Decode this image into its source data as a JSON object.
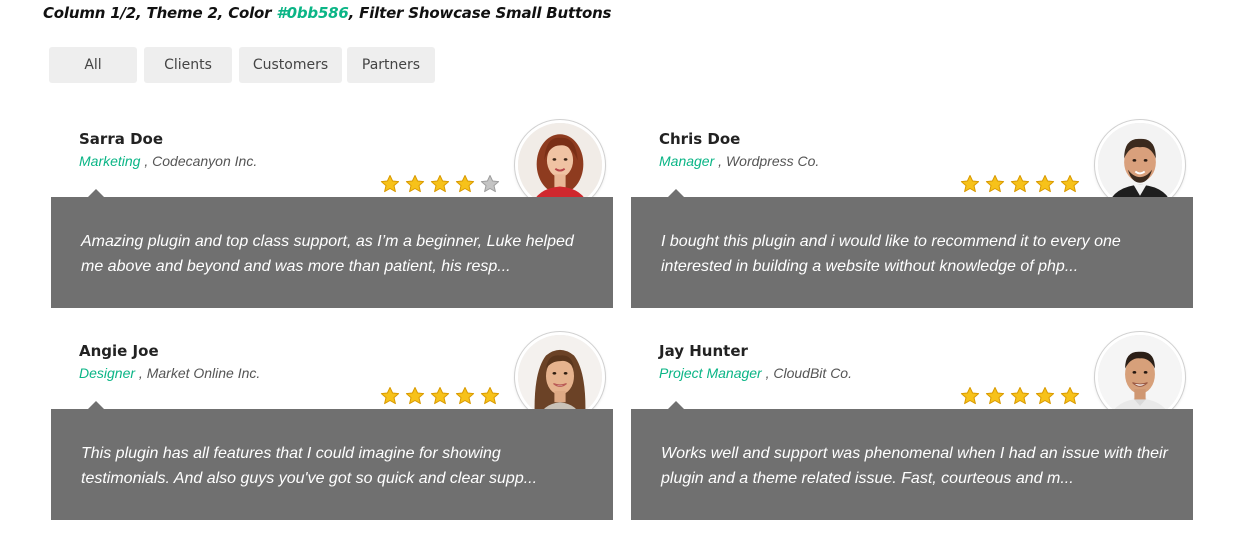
{
  "heading": {
    "prefix": "Column 1/2, Theme 2, Color ",
    "color_text": "#0bb586",
    "suffix": ", Filter Showcase Small Buttons"
  },
  "accent_color": "#0bb586",
  "filters": [
    "All",
    "Clients",
    "Customers",
    "Partners"
  ],
  "testimonials": [
    {
      "name": "Sarra Doe",
      "role": "Marketing",
      "separator": " , ",
      "company": "Codecanyon Inc.",
      "rating": 4,
      "quote": "Amazing plugin and top class support, as I’m a beginner, Luke helped me above and beyond and was more than patient, his resp...",
      "avatar": "woman-red-hair-photo"
    },
    {
      "name": "Chris Doe",
      "role": "Manager",
      "separator": " , ",
      "company": "Wordpress Co.",
      "rating": 5,
      "quote": "I bought this plugin and i would like to recommend it to every one interested in building a website without knowledge of php...",
      "avatar": "bearded-man-photo"
    },
    {
      "name": "Angie Joe",
      "role": "Designer",
      "separator": " , ",
      "company": "Market Online Inc.",
      "rating": 5,
      "quote": "This plugin has all features that I could imagine for showing testimonials. And also guys you've got so quick and clear supp...",
      "avatar": "smiling-woman-photo"
    },
    {
      "name": "Jay Hunter",
      "role": "Project Manager",
      "separator": " , ",
      "company": "CloudBit Co.",
      "rating": 5,
      "quote": "Works well and support was phenomenal when I had an issue with their plugin and a theme related issue. Fast, courteous and m...",
      "avatar": "smiling-man-photo"
    }
  ]
}
